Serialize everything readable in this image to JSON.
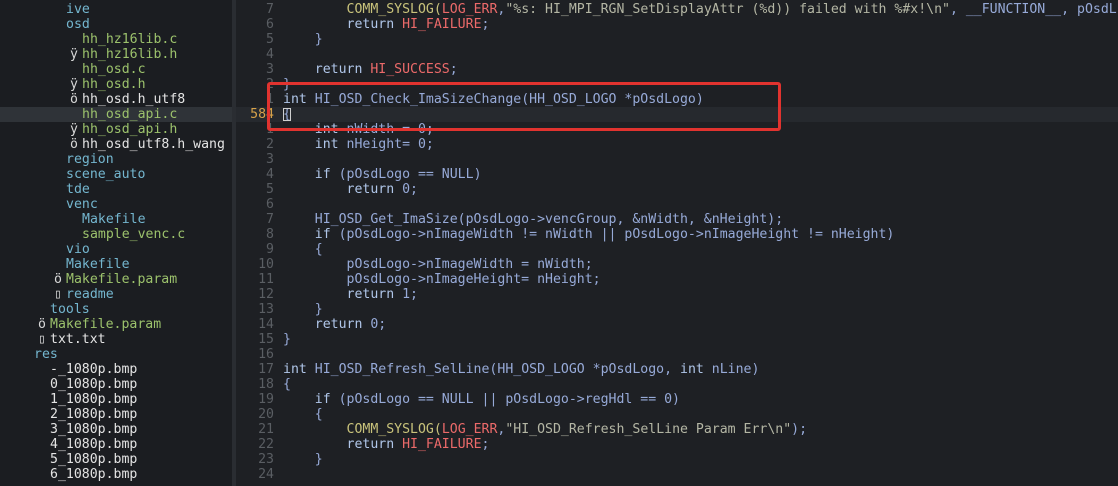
{
  "sidebar": {
    "items": [
      {
        "mark": "",
        "name": "ive",
        "color": "blue",
        "indent": 66
      },
      {
        "mark": "",
        "name": "osd",
        "color": "blue",
        "indent": 66
      },
      {
        "mark": "",
        "name": "hh_hz16lib.c",
        "color": "green",
        "indent": 82
      },
      {
        "mark": "ÿ",
        "name": "hh_hz16lib.h",
        "color": "green",
        "indent": 82
      },
      {
        "mark": "",
        "name": "hh_osd.c",
        "color": "green",
        "indent": 82
      },
      {
        "mark": "ÿ",
        "name": "hh_osd.h",
        "color": "green",
        "indent": 82
      },
      {
        "mark": "ö",
        "name": "hh_osd.h_utf8",
        "color": "white",
        "indent": 82
      },
      {
        "mark": "",
        "name": "hh_osd_api.c",
        "color": "green",
        "indent": 82,
        "selected": true
      },
      {
        "mark": "ÿ",
        "name": "hh_osd_api.h",
        "color": "green",
        "indent": 82
      },
      {
        "mark": "ö",
        "name": "hh_osd_utf8.h_wang",
        "color": "white",
        "indent": 82
      },
      {
        "mark": "",
        "name": "region",
        "color": "blue",
        "indent": 66
      },
      {
        "mark": "",
        "name": "scene_auto",
        "color": "blue",
        "indent": 66
      },
      {
        "mark": "",
        "name": "tde",
        "color": "blue",
        "indent": 66
      },
      {
        "mark": "",
        "name": "venc",
        "color": "blue",
        "indent": 66
      },
      {
        "mark": "",
        "name": "Makefile",
        "color": "blue",
        "indent": 82
      },
      {
        "mark": "",
        "name": "sample_venc.c",
        "color": "green",
        "indent": 82
      },
      {
        "mark": "",
        "name": "vio",
        "color": "blue",
        "indent": 66
      },
      {
        "mark": "",
        "name": "Makefile",
        "color": "blue",
        "indent": 66
      },
      {
        "mark": "ö",
        "name": "Makefile.param",
        "color": "green",
        "indent": 66
      },
      {
        "mark": "▯",
        "name": "readme",
        "color": "blue",
        "indent": 66
      },
      {
        "mark": "",
        "name": "tools",
        "color": "blue",
        "indent": 50
      },
      {
        "mark": "ö",
        "name": "Makefile.param",
        "color": "green",
        "indent": 50
      },
      {
        "mark": "▯",
        "name": "txt.txt",
        "color": "white",
        "indent": 50
      },
      {
        "mark": "",
        "name": "res",
        "color": "blue",
        "indent": 34
      },
      {
        "mark": "",
        "name": "-_1080p.bmp",
        "color": "white",
        "indent": 50
      },
      {
        "mark": "",
        "name": "0_1080p.bmp",
        "color": "white",
        "indent": 50
      },
      {
        "mark": "",
        "name": "1_1080p.bmp",
        "color": "white",
        "indent": 50
      },
      {
        "mark": "",
        "name": "2_1080p.bmp",
        "color": "white",
        "indent": 50
      },
      {
        "mark": "",
        "name": "3_1080p.bmp",
        "color": "white",
        "indent": 50
      },
      {
        "mark": "",
        "name": "4_1080p.bmp",
        "color": "white",
        "indent": 50
      },
      {
        "mark": "",
        "name": "5_1080p.bmp",
        "color": "white",
        "indent": 50
      },
      {
        "mark": "",
        "name": "6_1080p.bmp",
        "color": "white",
        "indent": 50
      }
    ]
  },
  "editor": {
    "current_line": "584",
    "lines": [
      {
        "num": "7",
        "tokens": [
          [
            "        ",
            "plain"
          ],
          [
            "COMM_SYSLOG(",
            "macro"
          ],
          [
            "LOG_ERR",
            "red"
          ],
          [
            ",",
            "plain"
          ],
          [
            "\"%s: HI_MPI_RGN_SetDisplayAttr (%d)) failed with %#x!\\n\"",
            "str"
          ],
          [
            ", __FUNCTION__, pOsdL",
            "plain"
          ]
        ]
      },
      {
        "num": "6",
        "tokens": [
          [
            "        ",
            "plain"
          ],
          [
            "return ",
            "kw"
          ],
          [
            "HI_FAILURE",
            "red"
          ],
          [
            ";",
            "plain"
          ]
        ]
      },
      {
        "num": "5",
        "tokens": [
          [
            "    }",
            "plain"
          ]
        ]
      },
      {
        "num": "4",
        "tokens": []
      },
      {
        "num": "3",
        "tokens": [
          [
            "    ",
            "plain"
          ],
          [
            "return ",
            "kw"
          ],
          [
            "HI_SUCCESS",
            "red"
          ],
          [
            ";",
            "plain"
          ]
        ]
      },
      {
        "num": "2",
        "tokens": [
          [
            "}",
            "plain"
          ]
        ]
      },
      {
        "num": "1",
        "tokens": [
          [
            "int ",
            "kw"
          ],
          [
            "HI_OSD_Check_ImaSizeChange(HH_OSD_LOGO *pOsdLogo)",
            "plain"
          ]
        ]
      },
      {
        "num": "584",
        "current": true,
        "tokens": [
          [
            "{",
            "plain"
          ]
        ]
      },
      {
        "num": "1",
        "tokens": [
          [
            "    ",
            "plain"
          ],
          [
            "int ",
            "kw"
          ],
          [
            "nWidth = 0;",
            "plain"
          ]
        ]
      },
      {
        "num": "2",
        "tokens": [
          [
            "    ",
            "plain"
          ],
          [
            "int ",
            "kw"
          ],
          [
            "nHeight= 0;",
            "plain"
          ]
        ]
      },
      {
        "num": "3",
        "tokens": []
      },
      {
        "num": "4",
        "tokens": [
          [
            "    ",
            "plain"
          ],
          [
            "if ",
            "kw"
          ],
          [
            "(pOsdLogo == NULL)",
            "plain"
          ]
        ]
      },
      {
        "num": "5",
        "tokens": [
          [
            "        ",
            "plain"
          ],
          [
            "return ",
            "kw"
          ],
          [
            "0;",
            "plain"
          ]
        ]
      },
      {
        "num": "6",
        "tokens": []
      },
      {
        "num": "7",
        "tokens": [
          [
            "    HI_OSD_Get_ImaSize(pOsdLogo->vencGroup, &nWidth, &nHeight);",
            "plain"
          ]
        ]
      },
      {
        "num": "8",
        "tokens": [
          [
            "    ",
            "plain"
          ],
          [
            "if ",
            "kw"
          ],
          [
            "(pOsdLogo->nImageWidth != nWidth || pOsdLogo->nImageHeight != nHeight)",
            "plain"
          ]
        ]
      },
      {
        "num": "9",
        "tokens": [
          [
            "    {",
            "plain"
          ]
        ]
      },
      {
        "num": "10",
        "tokens": [
          [
            "        pOsdLogo->nImageWidth = nWidth;",
            "plain"
          ]
        ]
      },
      {
        "num": "11",
        "tokens": [
          [
            "        pOsdLogo->nImageHeight= nHeight;",
            "plain"
          ]
        ]
      },
      {
        "num": "12",
        "tokens": [
          [
            "        ",
            "plain"
          ],
          [
            "return ",
            "kw"
          ],
          [
            "1;",
            "plain"
          ]
        ]
      },
      {
        "num": "13",
        "tokens": [
          [
            "    }",
            "plain"
          ]
        ]
      },
      {
        "num": "14",
        "tokens": [
          [
            "    ",
            "plain"
          ],
          [
            "return ",
            "kw"
          ],
          [
            "0;",
            "plain"
          ]
        ]
      },
      {
        "num": "15",
        "tokens": [
          [
            "}",
            "plain"
          ]
        ]
      },
      {
        "num": "16",
        "tokens": []
      },
      {
        "num": "17",
        "tokens": [
          [
            "int ",
            "kw"
          ],
          [
            "HI_OSD_Refresh_SelLine(HH_OSD_LOGO *pOsdLogo, ",
            "plain"
          ],
          [
            "int ",
            "kw"
          ],
          [
            "nLine)",
            "plain"
          ]
        ]
      },
      {
        "num": "18",
        "tokens": [
          [
            "{",
            "plain"
          ]
        ]
      },
      {
        "num": "19",
        "tokens": [
          [
            "    ",
            "plain"
          ],
          [
            "if ",
            "kw"
          ],
          [
            "(pOsdLogo == NULL || pOsdLogo->regHdl == 0)",
            "plain"
          ]
        ]
      },
      {
        "num": "20",
        "tokens": [
          [
            "    {",
            "plain"
          ]
        ]
      },
      {
        "num": "21",
        "tokens": [
          [
            "        ",
            "plain"
          ],
          [
            "COMM_SYSLOG(",
            "macro"
          ],
          [
            "LOG_ERR",
            "red"
          ],
          [
            ",",
            "plain"
          ],
          [
            "\"HI_OSD_Refresh_SelLine Param Err\\n\"",
            "str"
          ],
          [
            ");",
            "plain"
          ]
        ]
      },
      {
        "num": "22",
        "tokens": [
          [
            "        ",
            "plain"
          ],
          [
            "return ",
            "kw"
          ],
          [
            "HI_FAILURE",
            "red"
          ],
          [
            ";",
            "plain"
          ]
        ]
      },
      {
        "num": "23",
        "tokens": [
          [
            "    }",
            "plain"
          ]
        ]
      },
      {
        "num": "24",
        "tokens": []
      }
    ]
  },
  "colors": {
    "highlight_box": "#e1332f",
    "current_line_number": "#d7a24a"
  }
}
